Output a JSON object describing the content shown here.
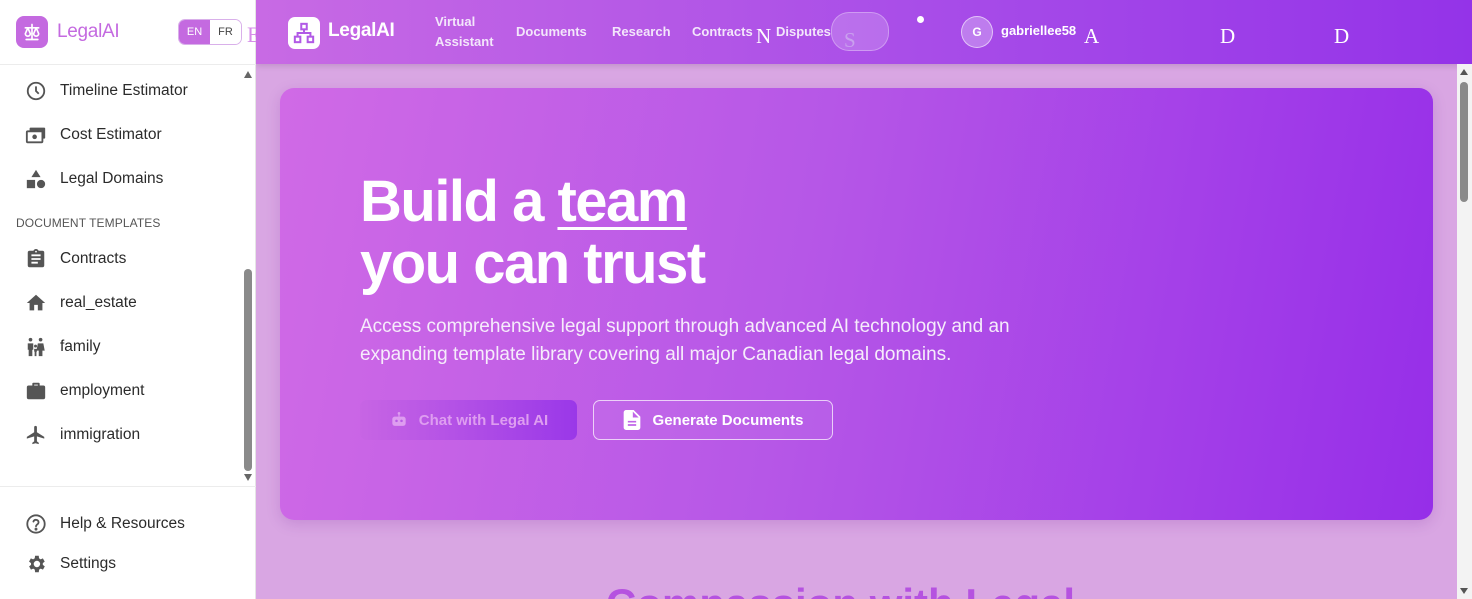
{
  "sidebar": {
    "brand": "LegalAI",
    "lang": {
      "en": "EN",
      "fr": "FR",
      "stray_char": "E"
    },
    "items_top": [
      {
        "label": "Timeline Estimator",
        "icon": "clock-icon"
      },
      {
        "label": "Cost Estimator",
        "icon": "cash-icon"
      },
      {
        "label": "Legal Domains",
        "icon": "shapes-icon"
      }
    ],
    "section_label": "DOCUMENT TEMPLATES",
    "templates": [
      {
        "label": "Contracts",
        "icon": "clipboard-icon"
      },
      {
        "label": "real_estate",
        "icon": "home-icon"
      },
      {
        "label": "family",
        "icon": "family-icon"
      },
      {
        "label": "employment",
        "icon": "briefcase-icon"
      },
      {
        "label": "immigration",
        "icon": "airplane-icon"
      }
    ],
    "bottom": [
      {
        "label": "Help & Resources",
        "icon": "help-icon"
      },
      {
        "label": "Settings",
        "icon": "gear-icon"
      }
    ]
  },
  "nav": {
    "brand": "LegalAI",
    "links": {
      "virtual_assistant_1": "Virtual",
      "virtual_assistant_2": "Assistant",
      "documents": "Documents",
      "research": "Research",
      "contracts": "Contracts",
      "disputes": "Disputes"
    },
    "stray": {
      "n": "N",
      "s": "S",
      "a": "A",
      "d1": "D",
      "d2": "D"
    },
    "avatar_initial": "G",
    "username": "gabriellee58"
  },
  "hero": {
    "title_part1": "Build a ",
    "title_underlined": "team",
    "title_line2": "you can trust",
    "subtitle": "Access comprehensive legal support through advanced AI technology and an expanding template library covering all major Canadian legal domains.",
    "chat_button": "Chat with Legal AI",
    "generate_button": "Generate Documents"
  },
  "below": {
    "partial_heading": "Compassion with Legal"
  },
  "colors": {
    "accent": "#c46ae0",
    "nav_start": "#c86ae4",
    "nav_end": "#9433e8",
    "main_bg": "#d9a6e3"
  }
}
